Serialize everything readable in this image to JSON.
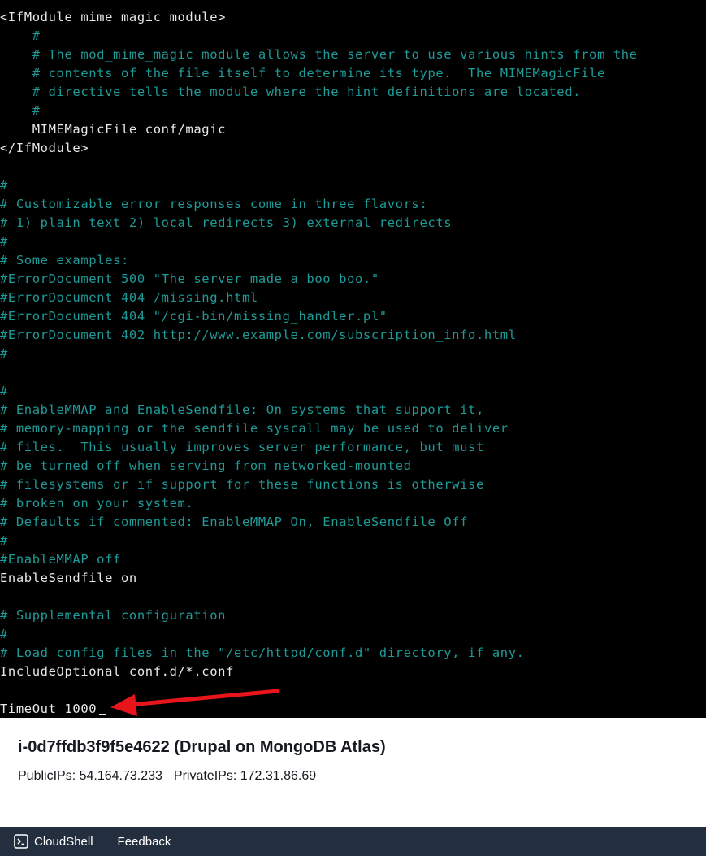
{
  "terminal": {
    "lines": [
      {
        "text": "<IfModule mime_magic_module>",
        "kind": "code"
      },
      {
        "text": "    #",
        "kind": "comment"
      },
      {
        "text": "    # The mod_mime_magic module allows the server to use various hints from the",
        "kind": "comment"
      },
      {
        "text": "    # contents of the file itself to determine its type.  The MIMEMagicFile",
        "kind": "comment"
      },
      {
        "text": "    # directive tells the module where the hint definitions are located.",
        "kind": "comment"
      },
      {
        "text": "    #",
        "kind": "comment"
      },
      {
        "text": "    MIMEMagicFile conf/magic",
        "kind": "code"
      },
      {
        "text": "</IfModule>",
        "kind": "code"
      },
      {
        "text": "",
        "kind": "code"
      },
      {
        "text": "#",
        "kind": "comment"
      },
      {
        "text": "# Customizable error responses come in three flavors:",
        "kind": "comment"
      },
      {
        "text": "# 1) plain text 2) local redirects 3) external redirects",
        "kind": "comment"
      },
      {
        "text": "#",
        "kind": "comment"
      },
      {
        "text": "# Some examples:",
        "kind": "comment"
      },
      {
        "text": "#ErrorDocument 500 \"The server made a boo boo.\"",
        "kind": "comment"
      },
      {
        "text": "#ErrorDocument 404 /missing.html",
        "kind": "comment"
      },
      {
        "text": "#ErrorDocument 404 \"/cgi-bin/missing_handler.pl\"",
        "kind": "comment"
      },
      {
        "text": "#ErrorDocument 402 http://www.example.com/subscription_info.html",
        "kind": "comment"
      },
      {
        "text": "#",
        "kind": "comment"
      },
      {
        "text": "",
        "kind": "code"
      },
      {
        "text": "#",
        "kind": "comment"
      },
      {
        "text": "# EnableMMAP and EnableSendfile: On systems that support it,",
        "kind": "comment"
      },
      {
        "text": "# memory-mapping or the sendfile syscall may be used to deliver",
        "kind": "comment"
      },
      {
        "text": "# files.  This usually improves server performance, but must",
        "kind": "comment"
      },
      {
        "text": "# be turned off when serving from networked-mounted",
        "kind": "comment"
      },
      {
        "text": "# filesystems or if support for these functions is otherwise",
        "kind": "comment"
      },
      {
        "text": "# broken on your system.",
        "kind": "comment"
      },
      {
        "text": "# Defaults if commented: EnableMMAP On, EnableSendfile Off",
        "kind": "comment"
      },
      {
        "text": "#",
        "kind": "comment"
      },
      {
        "text": "#EnableMMAP off",
        "kind": "comment"
      },
      {
        "text": "EnableSendfile on",
        "kind": "code"
      },
      {
        "text": "",
        "kind": "code"
      },
      {
        "text": "# Supplemental configuration",
        "kind": "comment"
      },
      {
        "text": "#",
        "kind": "comment"
      },
      {
        "text": "# Load config files in the \"/etc/httpd/conf.d\" directory, if any.",
        "kind": "comment"
      },
      {
        "text": "IncludeOptional conf.d/*.conf",
        "kind": "code"
      },
      {
        "text": "",
        "kind": "code"
      },
      {
        "text": "TimeOut 1000",
        "kind": "code",
        "cursor": true
      }
    ]
  },
  "colors": {
    "terminal_bg": "#000000",
    "code_text": "#e8e8e8",
    "comment_text": "#1e9a97",
    "arrow": "#e8141b",
    "footer_bg": "#232f3e"
  },
  "instance": {
    "title": "i-0d7ffdb3f9f5e4622 (Drupal on MongoDB Atlas)",
    "public_ips": "PublicIPs: 54.164.73.233",
    "private_ips": "PrivateIPs: 172.31.86.69"
  },
  "footer": {
    "cloudshell_label": "CloudShell",
    "cloudshell_icon": "cloudshell-icon",
    "feedback_label": "Feedback"
  }
}
